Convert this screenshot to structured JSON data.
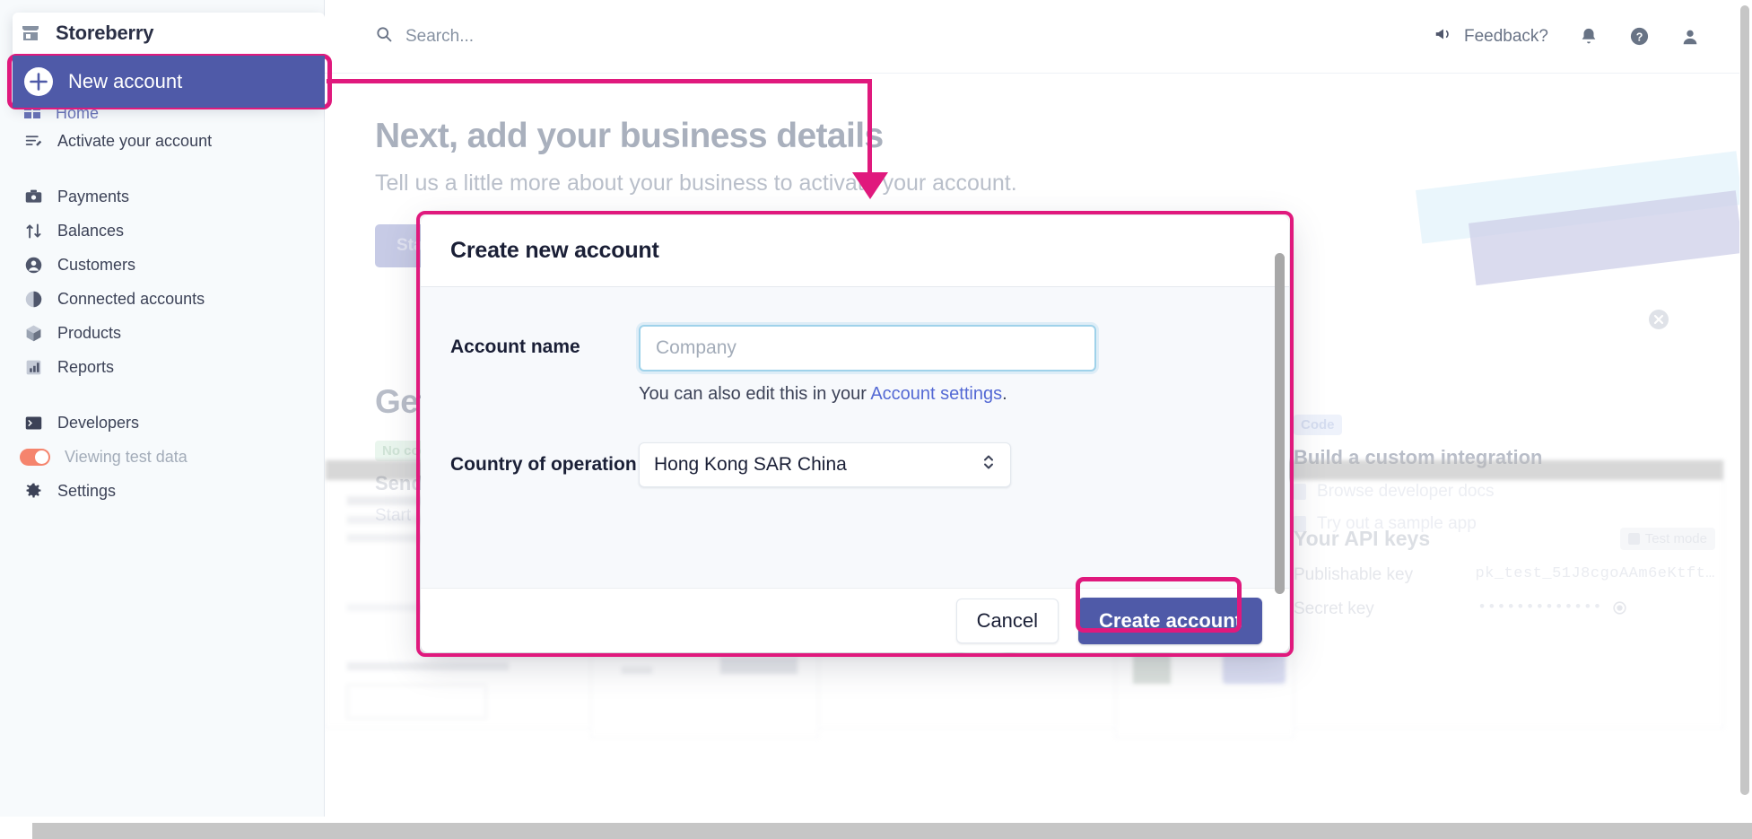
{
  "sidebar": {
    "brand": "Storeberry",
    "new_account": "New account",
    "hidden_item": "Home",
    "items": [
      {
        "label": "Activate your account",
        "icon": "activate-icon"
      },
      {
        "label": "Payments",
        "icon": "payments-icon"
      },
      {
        "label": "Balances",
        "icon": "balances-icon"
      },
      {
        "label": "Customers",
        "icon": "customers-icon"
      },
      {
        "label": "Connected accounts",
        "icon": "connected-accounts-icon"
      },
      {
        "label": "Products",
        "icon": "products-icon"
      },
      {
        "label": "Reports",
        "icon": "reports-icon"
      },
      {
        "label": "Developers",
        "icon": "developers-icon"
      },
      {
        "label": "Viewing test data",
        "icon": "toggle-switch"
      },
      {
        "label": "Settings",
        "icon": "gear-icon"
      }
    ]
  },
  "topbar": {
    "search_placeholder": "Search...",
    "feedback": "Feedback?",
    "icons": [
      "megaphone-icon",
      "bell-icon",
      "help-icon",
      "account-icon"
    ]
  },
  "main": {
    "title": "Next, add your business details",
    "subtitle": "Tell us a little more about your business to activate your account.",
    "start_button": "Start",
    "get_started_title": "Get started",
    "no_code_badge": "No code",
    "no_code_heading": "Send an invoice",
    "no_code_link": "Start",
    "code_badge": "Code",
    "code_heading": "Build a custom integration",
    "code_links": [
      "Browse developer docs",
      "Try out a sample app"
    ],
    "api_title": "Your API keys",
    "test_mode": "Test mode",
    "publishable_key_label": "Publishable key",
    "publishable_key_value": "pk_test_51J8cgoAAm6eKtft…",
    "secret_key_label": "Secret key",
    "secret_key_value": "•••••••••••••"
  },
  "modal": {
    "title": "Create new account",
    "account_name_label": "Account name",
    "account_name_placeholder": "Company",
    "account_name_value": "",
    "help_prefix": "You can also edit this in your ",
    "help_link": "Account settings",
    "help_suffix": ".",
    "country_label": "Country of operation",
    "country_value": "Hong Kong SAR China",
    "cancel_label": "Cancel",
    "create_label": "Create account"
  },
  "colors": {
    "annotation": "#e0197d",
    "primary": "#4f5aa8",
    "nav_selected": "#4f5aa8",
    "link": "#5469d4"
  }
}
